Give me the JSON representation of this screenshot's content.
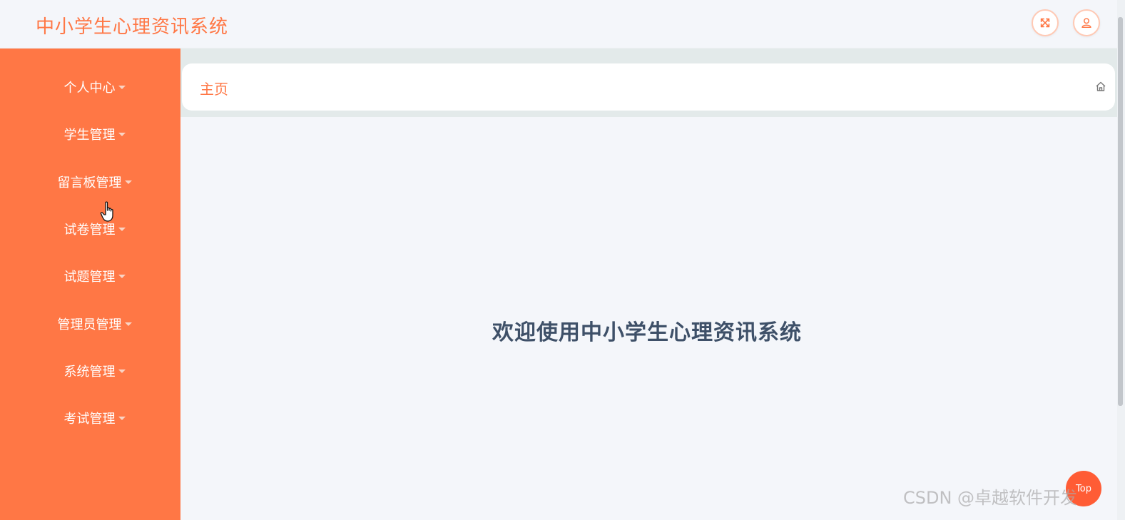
{
  "app": {
    "title": "中小学生心理资讯系统"
  },
  "header": {
    "fullscreen_icon": "fullscreen-icon",
    "user_icon": "user-icon"
  },
  "sidebar": {
    "items": [
      {
        "label": "个人中心"
      },
      {
        "label": "学生管理"
      },
      {
        "label": "留言板管理"
      },
      {
        "label": "试卷管理"
      },
      {
        "label": "试题管理"
      },
      {
        "label": "管理员管理"
      },
      {
        "label": "系统管理"
      },
      {
        "label": "考试管理"
      }
    ]
  },
  "breadcrumb": {
    "home_label": "主页",
    "icon": "home-icon"
  },
  "main": {
    "welcome_text": "欢迎使用中小学生心理资讯系统"
  },
  "fab": {
    "label": "Top"
  },
  "watermark": {
    "text": "CSDN @卓越软件开发"
  },
  "colors": {
    "accent": "#ff7745",
    "sidebar_bg": "#ff7745",
    "welcome_text": "#3e5068",
    "page_bg": "#f4f6fa"
  }
}
